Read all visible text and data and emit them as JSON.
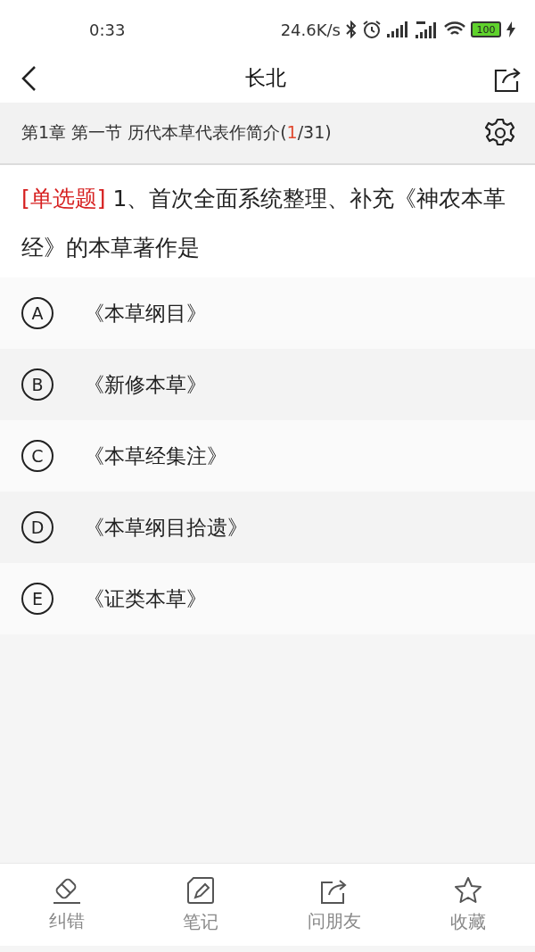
{
  "status_bar": {
    "time": "0:33",
    "speed": "24.6K/s",
    "battery": "100"
  },
  "nav": {
    "title": "长北"
  },
  "progress": {
    "prefix": "第1章 第一节 历代本草代表作简介(",
    "current": "1",
    "suffix": "/31)"
  },
  "question": {
    "type_tag": "[单选题]",
    "text": "1、首次全面系统整理、补充《神农本革经》的本草著作是"
  },
  "options": [
    {
      "letter": "A",
      "text": "《本草纲目》",
      "selected": false
    },
    {
      "letter": "B",
      "text": "《新修本草》",
      "selected": false
    },
    {
      "letter": "C",
      "text": "《本草经集注》",
      "selected": false
    },
    {
      "letter": "D",
      "text": "《本草纲目拾遗》",
      "selected": false
    },
    {
      "letter": "E",
      "text": "《证类本草》",
      "selected": false
    }
  ],
  "toolbar": [
    {
      "kind": "eraser",
      "label": "纠错"
    },
    {
      "kind": "note",
      "label": "笔记"
    },
    {
      "kind": "share",
      "label": "问朋友"
    },
    {
      "kind": "star",
      "label": "收藏"
    }
  ]
}
